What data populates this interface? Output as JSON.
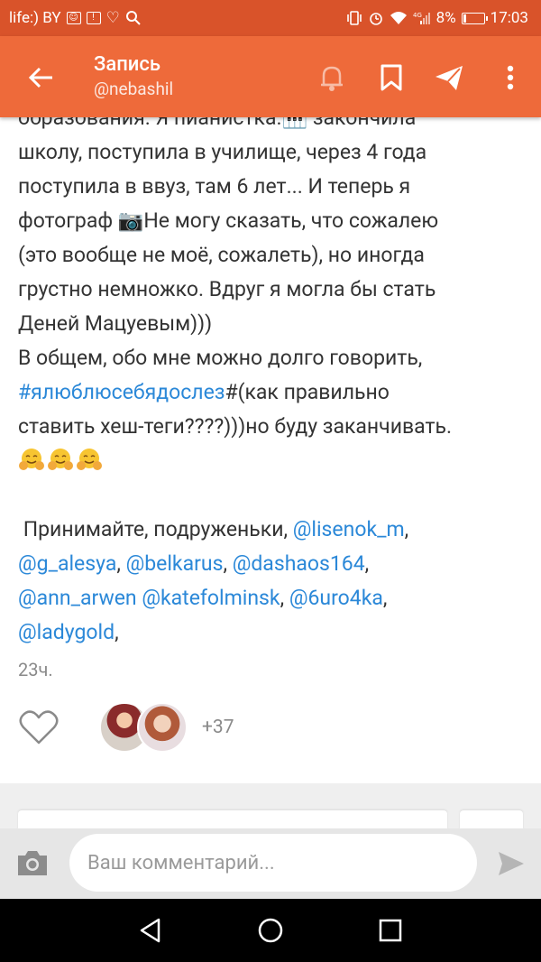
{
  "status_bar": {
    "carrier": "life:) BY",
    "network": "4G",
    "battery": "8%",
    "time": "17:03"
  },
  "app_bar": {
    "title": "Запись",
    "subtitle": "@nebashil",
    "icons": [
      "back-arrow-icon",
      "bell-icon",
      "bookmark-icon",
      "send-icon",
      "more-vert-icon"
    ]
  },
  "post": {
    "line0": "образования. Я пианистка.🎹 закончила",
    "line1": "школу, поступила в училище, через 4 года",
    "line2": "поступила в ввуз, там 6 лет... И теперь я",
    "line3a": "фотограф ",
    "camera_emoji": "📷",
    "line3b": "Не могу сказать, что сожалею",
    "line4": "(это вообще не моё, сожалеть), но иногда",
    "line5": "грустно немножко. Вдруг я могла бы стать",
    "line6": "Деней Мацуевым)))",
    "line7": "В общем, обо мне можно долго говорить,",
    "hashtag": "#ялюблюсебядослез",
    "line8b": "#(как правильно",
    "line9": "ставить хеш-теги????)))но буду заканчивать.",
    "hug_emoji": "🤗",
    "invite": " Принимайте, подруженьки, ",
    "mentions": {
      "m1": "@lisenok_m",
      "m2": "@g_alesya",
      "m3": "@belkarus",
      "m4": "@dashaos164",
      "m5": "@ann_arwen",
      "m6": "@katefolminsk",
      "m7": "@6uro4ka",
      "m8": "@ladygold"
    },
    "time": "23ч.",
    "likes_more": "+37"
  },
  "comment": {
    "placeholder": "Ваш комментарий..."
  },
  "colors": {
    "status_bar": "#d9532a",
    "app_bar": "#ee6a3a",
    "link": "#2b88d8"
  }
}
